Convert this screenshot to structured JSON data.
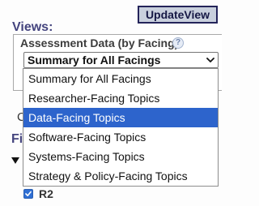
{
  "toolbar": {
    "update_view_label": "UpdateView"
  },
  "views": {
    "heading": "Views:",
    "assessment_label": "Assessment Data (by Facing):",
    "help_glyph": "?",
    "selected_value": "Summary for All Facings",
    "options": [
      "Summary for All Facings",
      "Researcher-Facing Topics",
      "Data-Facing Topics",
      "Software-Facing Topics",
      "Systems-Facing Topics",
      "Strategy & Policy-Facing Topics"
    ],
    "highlighted_option": "Data-Facing Topics",
    "peek_letter_1": "C",
    "peek_letter_2": "C"
  },
  "filters": {
    "heading_peek": "Fi",
    "checkbox_label": "R2",
    "checkbox_checked": true
  },
  "icons": {
    "help": "question-circle-icon",
    "select_arrow": "chevron-down-icon",
    "collapse": "triangle-down-icon",
    "check": "checkmark-icon"
  },
  "colors": {
    "heading": "#44447e",
    "button_bg": "#c9d0dd",
    "button_border": "#24245a",
    "highlight": "#2d64cc",
    "checkbox": "#2f6fd4"
  }
}
